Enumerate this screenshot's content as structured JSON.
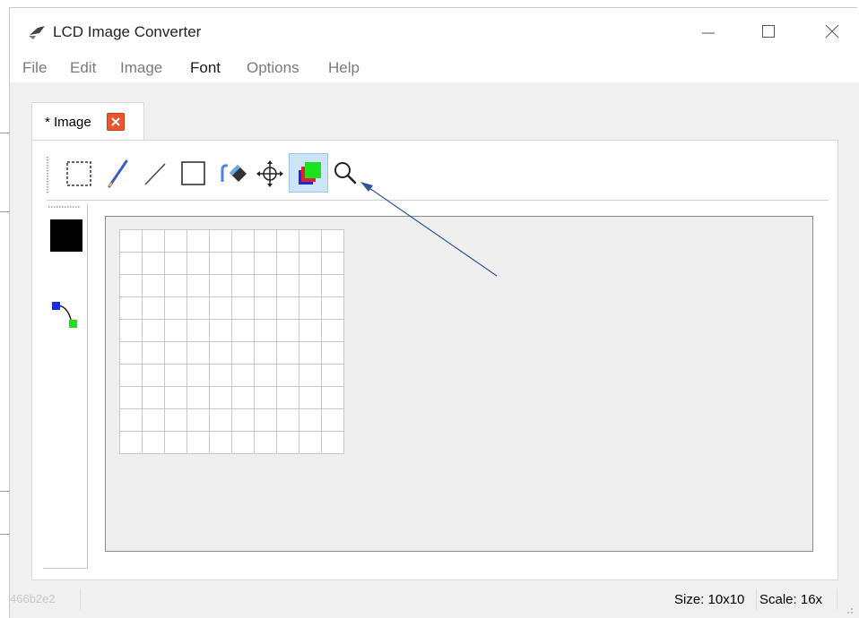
{
  "window": {
    "title": "LCD Image Converter",
    "controls": [
      "minimize",
      "maximize",
      "close"
    ]
  },
  "menu": {
    "items": [
      "File",
      "Edit",
      "Image",
      "Font",
      "Options",
      "Help"
    ]
  },
  "tab": {
    "label": "* Image"
  },
  "toolbar": {
    "tools": [
      {
        "name": "select-rect-tool",
        "icon": "dashed-rectangle-icon",
        "active": false
      },
      {
        "name": "pen-tool",
        "icon": "pencil-icon",
        "active": false
      },
      {
        "name": "line-tool",
        "icon": "line-icon",
        "active": false
      },
      {
        "name": "rectangle-tool",
        "icon": "rectangle-icon",
        "active": false
      },
      {
        "name": "fill-tool",
        "icon": "paint-bucket-icon",
        "active": false
      },
      {
        "name": "move-tool",
        "icon": "move-arrows-icon",
        "active": false
      },
      {
        "name": "color-tool",
        "icon": "color-layers-icon",
        "active": true
      },
      {
        "name": "zoom-tool",
        "icon": "magnifier-icon",
        "active": false
      }
    ]
  },
  "side_panel": {
    "foreground_color": "#000000",
    "swap_icon": "swap-colors-icon"
  },
  "canvas": {
    "grid_columns": 10,
    "grid_rows": 10
  },
  "status": {
    "hash": "466b2e2",
    "size": "Size: 10x10",
    "scale": "Scale: 16x"
  },
  "colors": {
    "accent": "#cce4f7",
    "close_tab": "#e8552f",
    "annotation_arrow": "#2f5597"
  }
}
